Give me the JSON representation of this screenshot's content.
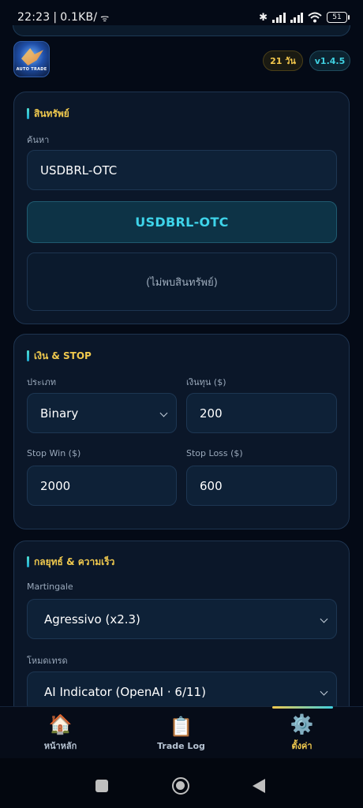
{
  "status": {
    "time": "22:23",
    "speed": "0.1KB/",
    "battery": "51"
  },
  "header": {
    "logo_text": "AUTO TRADE",
    "days_badge": "21 วัน",
    "version_badge": "v1.4.5"
  },
  "asset": {
    "title": "สินทรัพย์",
    "search_label": "ค้นหา",
    "search_value": "USDBRL-OTC",
    "selected": "USDBRL-OTC",
    "empty_text": "(ไม่พบสินทรัพย์)"
  },
  "money": {
    "title": "เงิน & STOP",
    "type_label": "ประเภท",
    "type_value": "Binary",
    "capital_label": "เงินทุน ($)",
    "capital_value": "200",
    "stop_win_label": "Stop Win ($)",
    "stop_win_value": "2000",
    "stop_loss_label": "Stop Loss ($)",
    "stop_loss_value": "600"
  },
  "strategy": {
    "title": "กลยุทธ์ & ความเร็ว",
    "martingale_label": "Martingale",
    "martingale_value": "Agressivo (x2.3)",
    "mode_label": "โหมดเทรด",
    "mode_value": "AI Indicator (OpenAI · 6/11)"
  },
  "bottom_nav": {
    "items": [
      {
        "label": "หน้าหลัก",
        "icon": "home-icon"
      },
      {
        "label": "Trade Log",
        "icon": "clipboard-icon"
      },
      {
        "label": "ตั้งค่า",
        "icon": "gear-icon"
      }
    ],
    "active": "ตั้งค่า"
  },
  "colors": {
    "background": "#040a16",
    "accent_gold": "#f0c94e",
    "accent_cyan": "#3ed4ea"
  }
}
